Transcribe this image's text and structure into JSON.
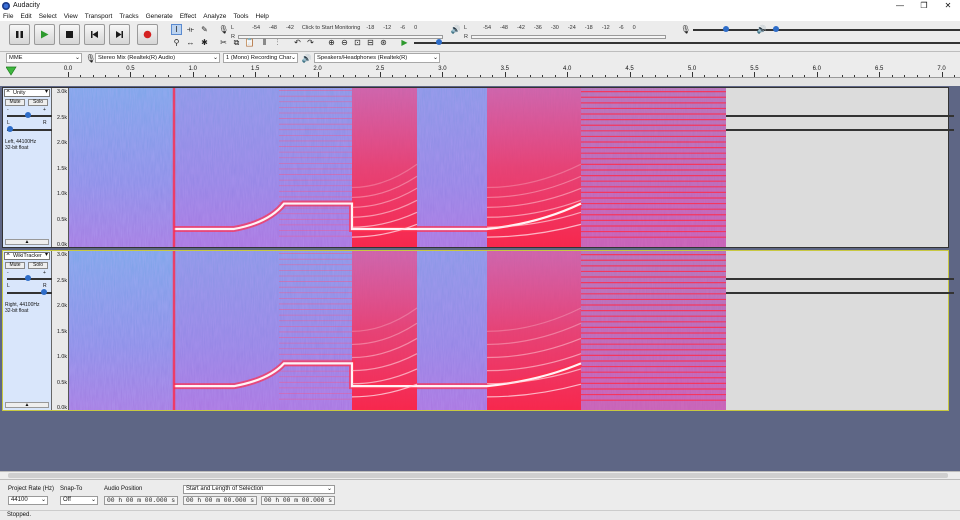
{
  "window": {
    "title": "Audacity",
    "minimize": "—",
    "maximize": "❐",
    "close": "✕"
  },
  "menu": [
    "File",
    "Edit",
    "Select",
    "View",
    "Transport",
    "Tracks",
    "Generate",
    "Effect",
    "Analyze",
    "Tools",
    "Help"
  ],
  "transport": {
    "pause": "pause-icon",
    "play": "play-icon",
    "stop": "stop-icon",
    "skip_start": "skip-start-icon",
    "skip_end": "skip-end-icon",
    "record": "record-icon"
  },
  "meters": {
    "record_scale": [
      "L",
      "R",
      "-54",
      "-48",
      "-42",
      "Click to Start Monitoring",
      "-18",
      "-12",
      "-6",
      "0"
    ],
    "play_scale": [
      "L",
      "R",
      "-54",
      "-48",
      "-42",
      "-36",
      "-30",
      "-24",
      "-18",
      "-12",
      "-6",
      "0"
    ]
  },
  "devices": {
    "host": "MME",
    "input": "Stereo Mix (Realtek(R) Audio)",
    "channels": "1 (Mono) Recording Char",
    "output": "Speakers/Headphones (Realtek(R)"
  },
  "ruler": [
    "0.0",
    "0.5",
    "1.0",
    "1.5",
    "2.0",
    "2.5",
    "3.0",
    "3.5",
    "4.0",
    "4.5",
    "5.0",
    "5.5",
    "6.0",
    "6.5",
    "7.0"
  ],
  "tracks": [
    {
      "name": "Unity",
      "mute": "Mute",
      "solo": "Solo",
      "info1": "Left, 44100Hz",
      "info2": "32-bit float",
      "scale": [
        "3.0k",
        "2.5k",
        "2.0k",
        "1.5k",
        "1.0k",
        "0.5k",
        "0.0k"
      ],
      "pan_l": "L",
      "pan_r": "R",
      "gain_minus": "-",
      "gain_plus": "+"
    },
    {
      "name": "WikiTracker",
      "mute": "Mute",
      "solo": "Solo",
      "info1": "Right, 44100Hz",
      "info2": "32-bit float",
      "scale": [
        "3.0k",
        "2.5k",
        "2.0k",
        "1.5k",
        "1.0k",
        "0.5k",
        "0.0k"
      ],
      "pan_l": "L",
      "pan_r": "R",
      "gain_minus": "-",
      "gain_plus": "+"
    }
  ],
  "selection_toolbar": {
    "rate_label": "Project Rate (Hz)",
    "rate_value": "44100",
    "snap_label": "Snap-To",
    "snap_value": "Off",
    "pos_label": "Audio Position",
    "pos_value": "00 h 00 m 00.000 s",
    "sel_mode": "Start and Length of Selection",
    "sel_start": "00 h 00 m 00.000 s",
    "sel_len": "00 h 00 m 00.000 s"
  },
  "status": "Stopped.",
  "colors": {
    "accent": "#2e6dc9",
    "track_bg": "#5e6685",
    "spec_low": "#6a8fe0",
    "spec_high": "#ff2a55"
  }
}
